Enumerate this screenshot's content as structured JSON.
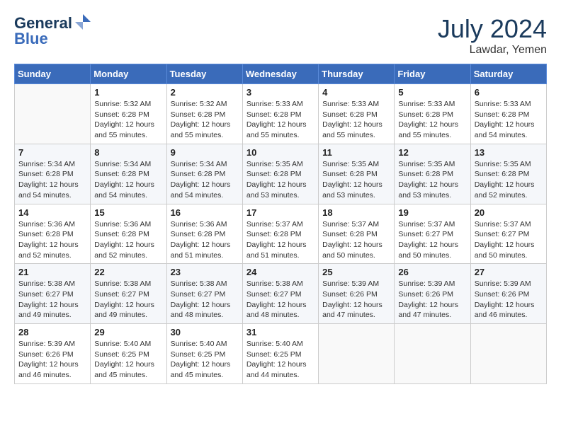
{
  "header": {
    "logo_line1": "General",
    "logo_line2": "Blue",
    "month_year": "July 2024",
    "location": "Lawdar, Yemen"
  },
  "calendar": {
    "days_of_week": [
      "Sunday",
      "Monday",
      "Tuesday",
      "Wednesday",
      "Thursday",
      "Friday",
      "Saturday"
    ],
    "weeks": [
      [
        {
          "day": "",
          "info": ""
        },
        {
          "day": "1",
          "info": "Sunrise: 5:32 AM\nSunset: 6:28 PM\nDaylight: 12 hours\nand 55 minutes."
        },
        {
          "day": "2",
          "info": "Sunrise: 5:32 AM\nSunset: 6:28 PM\nDaylight: 12 hours\nand 55 minutes."
        },
        {
          "day": "3",
          "info": "Sunrise: 5:33 AM\nSunset: 6:28 PM\nDaylight: 12 hours\nand 55 minutes."
        },
        {
          "day": "4",
          "info": "Sunrise: 5:33 AM\nSunset: 6:28 PM\nDaylight: 12 hours\nand 55 minutes."
        },
        {
          "day": "5",
          "info": "Sunrise: 5:33 AM\nSunset: 6:28 PM\nDaylight: 12 hours\nand 55 minutes."
        },
        {
          "day": "6",
          "info": "Sunrise: 5:33 AM\nSunset: 6:28 PM\nDaylight: 12 hours\nand 54 minutes."
        }
      ],
      [
        {
          "day": "7",
          "info": "Sunrise: 5:34 AM\nSunset: 6:28 PM\nDaylight: 12 hours\nand 54 minutes."
        },
        {
          "day": "8",
          "info": "Sunrise: 5:34 AM\nSunset: 6:28 PM\nDaylight: 12 hours\nand 54 minutes."
        },
        {
          "day": "9",
          "info": "Sunrise: 5:34 AM\nSunset: 6:28 PM\nDaylight: 12 hours\nand 54 minutes."
        },
        {
          "day": "10",
          "info": "Sunrise: 5:35 AM\nSunset: 6:28 PM\nDaylight: 12 hours\nand 53 minutes."
        },
        {
          "day": "11",
          "info": "Sunrise: 5:35 AM\nSunset: 6:28 PM\nDaylight: 12 hours\nand 53 minutes."
        },
        {
          "day": "12",
          "info": "Sunrise: 5:35 AM\nSunset: 6:28 PM\nDaylight: 12 hours\nand 53 minutes."
        },
        {
          "day": "13",
          "info": "Sunrise: 5:35 AM\nSunset: 6:28 PM\nDaylight: 12 hours\nand 52 minutes."
        }
      ],
      [
        {
          "day": "14",
          "info": "Sunrise: 5:36 AM\nSunset: 6:28 PM\nDaylight: 12 hours\nand 52 minutes."
        },
        {
          "day": "15",
          "info": "Sunrise: 5:36 AM\nSunset: 6:28 PM\nDaylight: 12 hours\nand 52 minutes."
        },
        {
          "day": "16",
          "info": "Sunrise: 5:36 AM\nSunset: 6:28 PM\nDaylight: 12 hours\nand 51 minutes."
        },
        {
          "day": "17",
          "info": "Sunrise: 5:37 AM\nSunset: 6:28 PM\nDaylight: 12 hours\nand 51 minutes."
        },
        {
          "day": "18",
          "info": "Sunrise: 5:37 AM\nSunset: 6:28 PM\nDaylight: 12 hours\nand 50 minutes."
        },
        {
          "day": "19",
          "info": "Sunrise: 5:37 AM\nSunset: 6:27 PM\nDaylight: 12 hours\nand 50 minutes."
        },
        {
          "day": "20",
          "info": "Sunrise: 5:37 AM\nSunset: 6:27 PM\nDaylight: 12 hours\nand 50 minutes."
        }
      ],
      [
        {
          "day": "21",
          "info": "Sunrise: 5:38 AM\nSunset: 6:27 PM\nDaylight: 12 hours\nand 49 minutes."
        },
        {
          "day": "22",
          "info": "Sunrise: 5:38 AM\nSunset: 6:27 PM\nDaylight: 12 hours\nand 49 minutes."
        },
        {
          "day": "23",
          "info": "Sunrise: 5:38 AM\nSunset: 6:27 PM\nDaylight: 12 hours\nand 48 minutes."
        },
        {
          "day": "24",
          "info": "Sunrise: 5:38 AM\nSunset: 6:27 PM\nDaylight: 12 hours\nand 48 minutes."
        },
        {
          "day": "25",
          "info": "Sunrise: 5:39 AM\nSunset: 6:26 PM\nDaylight: 12 hours\nand 47 minutes."
        },
        {
          "day": "26",
          "info": "Sunrise: 5:39 AM\nSunset: 6:26 PM\nDaylight: 12 hours\nand 47 minutes."
        },
        {
          "day": "27",
          "info": "Sunrise: 5:39 AM\nSunset: 6:26 PM\nDaylight: 12 hours\nand 46 minutes."
        }
      ],
      [
        {
          "day": "28",
          "info": "Sunrise: 5:39 AM\nSunset: 6:26 PM\nDaylight: 12 hours\nand 46 minutes."
        },
        {
          "day": "29",
          "info": "Sunrise: 5:40 AM\nSunset: 6:25 PM\nDaylight: 12 hours\nand 45 minutes."
        },
        {
          "day": "30",
          "info": "Sunrise: 5:40 AM\nSunset: 6:25 PM\nDaylight: 12 hours\nand 45 minutes."
        },
        {
          "day": "31",
          "info": "Sunrise: 5:40 AM\nSunset: 6:25 PM\nDaylight: 12 hours\nand 44 minutes."
        },
        {
          "day": "",
          "info": ""
        },
        {
          "day": "",
          "info": ""
        },
        {
          "day": "",
          "info": ""
        }
      ]
    ]
  }
}
